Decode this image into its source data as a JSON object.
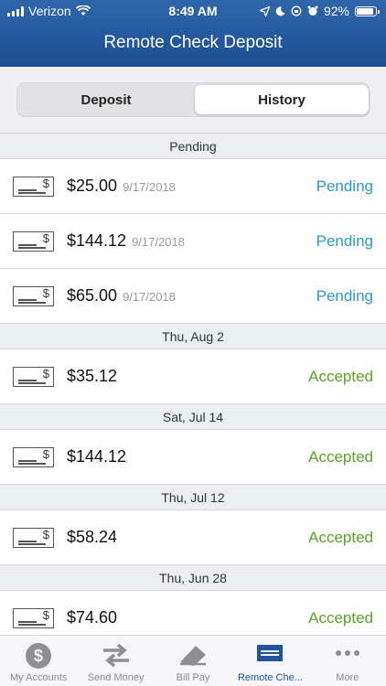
{
  "status_bar": {
    "carrier": "Verizon",
    "time": "8:49 AM",
    "battery": "92%"
  },
  "header": {
    "title": "Remote Check Deposit"
  },
  "segments": {
    "deposit": "Deposit",
    "history": "History",
    "selected": "History"
  },
  "sections": [
    {
      "title": "Pending",
      "items": [
        {
          "amount": "$25.00",
          "date": "9/17/2018",
          "status": "Pending"
        },
        {
          "amount": "$144.12",
          "date": "9/17/2018",
          "status": "Pending"
        },
        {
          "amount": "$65.00",
          "date": "9/17/2018",
          "status": "Pending"
        }
      ]
    },
    {
      "title": "Thu, Aug 2",
      "items": [
        {
          "amount": "$35.12",
          "date": "",
          "status": "Accepted"
        }
      ]
    },
    {
      "title": "Sat, Jul 14",
      "items": [
        {
          "amount": "$144.12",
          "date": "",
          "status": "Accepted"
        }
      ]
    },
    {
      "title": "Thu, Jul 12",
      "items": [
        {
          "amount": "$58.24",
          "date": "",
          "status": "Accepted"
        }
      ]
    },
    {
      "title": "Thu, Jun 28",
      "items": [
        {
          "amount": "$74.60",
          "date": "",
          "status": "Accepted"
        }
      ]
    }
  ],
  "tabbar": [
    {
      "label": "My Accounts",
      "icon": "dollar-coin-icon"
    },
    {
      "label": "Send Money",
      "icon": "transfer-arrows-icon"
    },
    {
      "label": "Bill Pay",
      "icon": "bill-pay-icon"
    },
    {
      "label": "Remote Che...",
      "icon": "check-deposit-icon",
      "active": true
    },
    {
      "label": "More",
      "icon": "more-dots-icon"
    }
  ],
  "colors": {
    "header": "#1c4e91",
    "pending": "#2a9bc1",
    "accepted": "#58a32c",
    "active_tab": "#2253a0"
  }
}
